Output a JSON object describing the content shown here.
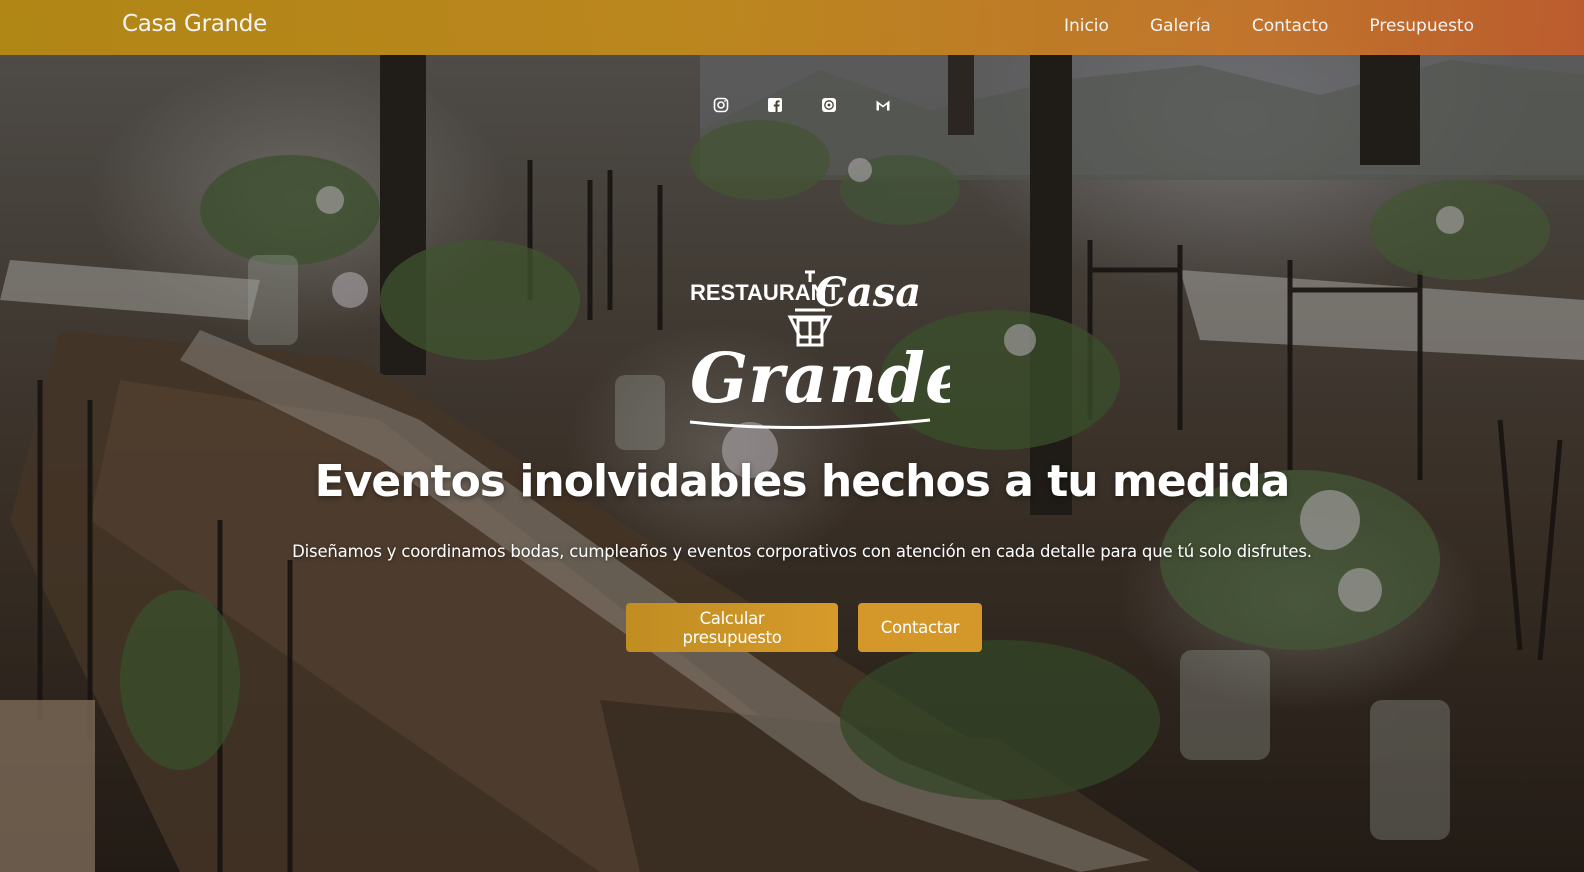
{
  "colors": {
    "navbar_gradient": [
      "#b78a12",
      "#c28a1c",
      "#c7762a",
      "#c25d2c"
    ],
    "button_primary": "#c99327",
    "button_secondary": "#d4972a",
    "text": "#ffffff"
  },
  "nav": {
    "brand": "Casa Grande",
    "links": [
      {
        "label": "Inicio"
      },
      {
        "label": "Galería"
      },
      {
        "label": "Contacto"
      },
      {
        "label": "Presupuesto"
      }
    ]
  },
  "social": [
    {
      "icon": "instagram-icon"
    },
    {
      "icon": "facebook-icon"
    },
    {
      "icon": "whatsapp-icon"
    },
    {
      "icon": "gmail-icon"
    }
  ],
  "logo": {
    "line1": "RESTAURANT",
    "line2": "Casa",
    "line3": "Grande"
  },
  "hero": {
    "headline": "Eventos inolvidables hechos a tu medida",
    "subtitle": "Diseñamos y coordinamos bodas, cumpleaños y eventos corporativos con atención en cada detalle para que tú solo disfrutes.",
    "primary_button": "Calcular presupuesto",
    "secondary_button": "Contactar"
  }
}
